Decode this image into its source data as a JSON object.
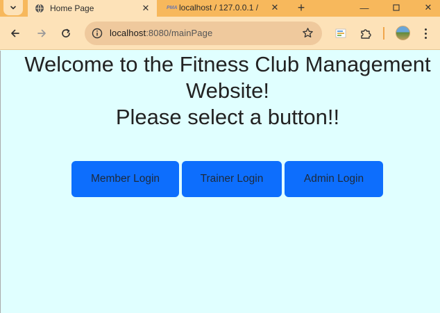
{
  "browser": {
    "tabs": [
      {
        "title": "Home Page",
        "active": true,
        "icon": "globe-icon"
      },
      {
        "title": "localhost / 127.0.0.1 /",
        "active": false,
        "icon": "pma-icon",
        "icon_text": "PMA"
      }
    ],
    "address": {
      "host": "localhost",
      "path": ":8080/mainPage"
    },
    "colors": {
      "tabstrip": "#f7b85c",
      "toolbar": "#fde2b8",
      "omnibox": "#efc99d"
    }
  },
  "page": {
    "heading_lines": [
      "Welcome to the Fitness Club Management",
      "Website!",
      "Please select a button!!"
    ],
    "buttons": {
      "member": "Member Login",
      "trainer": "Trainer Login",
      "admin": "Admin Login"
    },
    "colors": {
      "background": "#e0ffff",
      "button": "#0d6efd"
    }
  }
}
